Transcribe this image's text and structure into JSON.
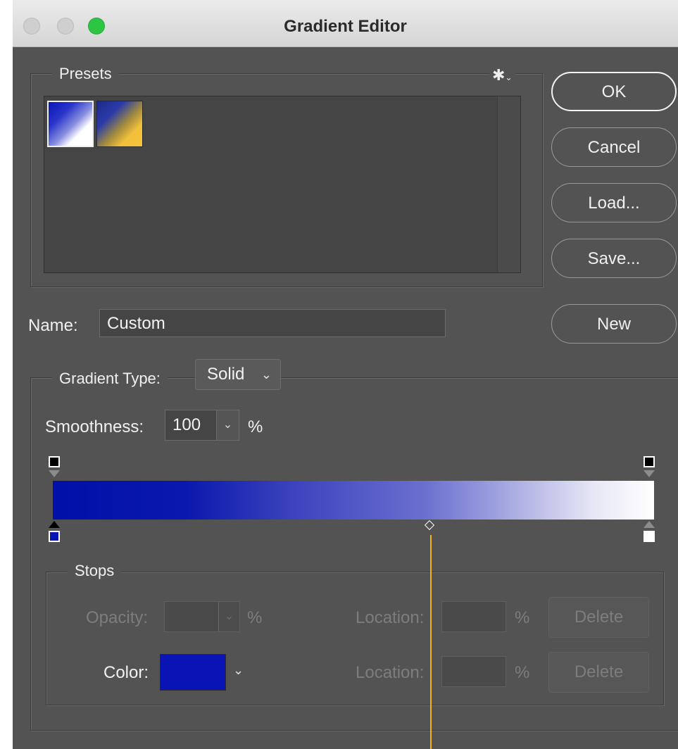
{
  "window": {
    "title": "Gradient Editor"
  },
  "presets": {
    "legend": "Presets",
    "gear_symbol": "✱",
    "items": [
      {
        "name": "blue-to-white",
        "colors": [
          "#0a14b8",
          "#ffffff"
        ]
      },
      {
        "name": "blue-to-yellow",
        "colors": [
          "#1e2a8a",
          "#f5c43e"
        ]
      }
    ]
  },
  "buttons": {
    "ok": "OK",
    "cancel": "Cancel",
    "load": "Load...",
    "save": "Save...",
    "new": "New"
  },
  "name": {
    "label": "Name:",
    "value": "Custom"
  },
  "gradient": {
    "legend_label": "Gradient Type:",
    "type_value": "Solid",
    "smoothness_label": "Smoothness:",
    "smoothness_value": "100",
    "smoothness_unit": "%",
    "colors": {
      "start": "#0010a8",
      "end": "#ffffff"
    }
  },
  "stops": {
    "legend": "Stops",
    "opacity_label": "Opacity:",
    "opacity_value": "",
    "opacity_unit": "%",
    "location_label": "Location:",
    "location_opacity_value": "",
    "location_color_value": "",
    "location_unit": "%",
    "delete_label": "Delete",
    "color_label": "Color:",
    "color_value": "#0a14b4"
  },
  "colors": {
    "panel_bg": "#535353",
    "titlebar": "#e0e0e0",
    "zoom_button": "#2fc544",
    "cursor_line": "#f3b21c"
  }
}
